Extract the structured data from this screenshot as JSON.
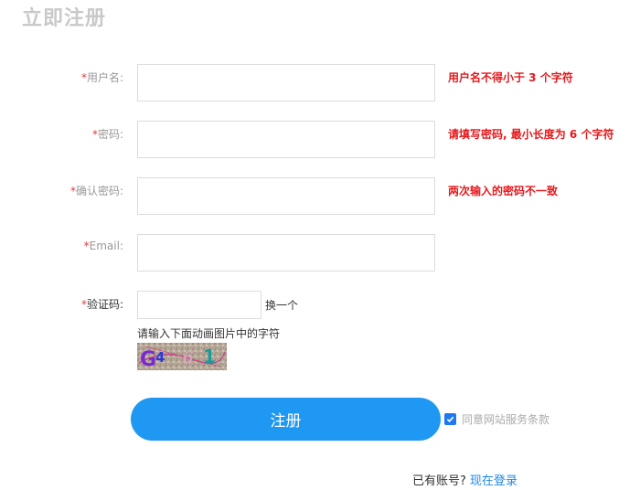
{
  "page": {
    "title": "立即注册"
  },
  "form": {
    "username": {
      "required_mark": "*",
      "label": "用户名:",
      "value": "",
      "error": "用户名不得小于 3 个字符"
    },
    "password": {
      "required_mark": "*",
      "label": "密码:",
      "value": "",
      "error": "请填写密码, 最小长度为 6 个字符"
    },
    "confirm": {
      "required_mark": "*",
      "label": "确认密码:",
      "value": "",
      "error": "两次输入的密码不一致"
    },
    "email": {
      "required_mark": "*",
      "label": "Email:",
      "value": ""
    },
    "captcha": {
      "required_mark": "*",
      "label": "验证码:",
      "value": "",
      "refresh_label": "换一个",
      "hint": "请输入下面动画图片中的字符",
      "image_text": "G4 6 1"
    },
    "submit_label": "注册",
    "agree": {
      "checked": true,
      "label": "同意网站服务条款"
    }
  },
  "footer": {
    "question": "已有账号?",
    "login_link": "现在登录"
  },
  "colors": {
    "accent": "#1e98f2",
    "error": "#e4191d",
    "required": "#e23a3a",
    "link": "#1e88e5"
  }
}
